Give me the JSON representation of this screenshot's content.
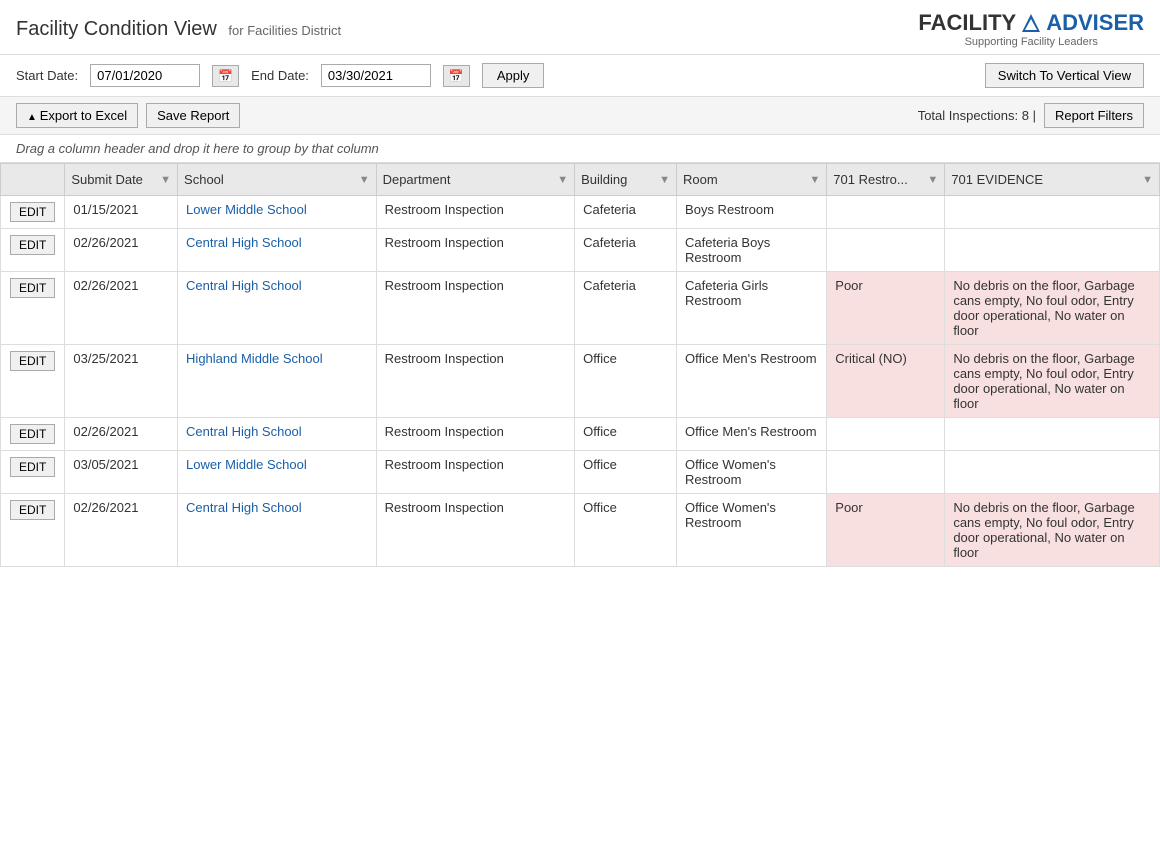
{
  "header": {
    "title": "Facility Condition View",
    "subtitle": "for Facilities District",
    "logo_main": "FACILITY",
    "logo_accent": "ADVISER",
    "logo_sub": "Supporting Facility Leaders"
  },
  "toolbar": {
    "start_date_label": "Start Date:",
    "start_date_value": "07/01/2020",
    "end_date_label": "End Date:",
    "end_date_value": "03/30/2021",
    "apply_label": "Apply",
    "switch_label": "Switch To Vertical View"
  },
  "action_bar": {
    "export_label": "Export to Excel",
    "save_label": "Save Report",
    "total_label": "Total Inspections: 8 |",
    "filters_label": "Report Filters"
  },
  "drag_hint": "Drag a column header and drop it here to group by that column",
  "table": {
    "columns": [
      {
        "key": "edit",
        "label": ""
      },
      {
        "key": "submit_date",
        "label": "Submit Date"
      },
      {
        "key": "school",
        "label": "School"
      },
      {
        "key": "department",
        "label": "Department"
      },
      {
        "key": "building",
        "label": "Building"
      },
      {
        "key": "room",
        "label": "Room"
      },
      {
        "key": "col701restro",
        "label": "701 Restro..."
      },
      {
        "key": "col701evidence",
        "label": "701 EVIDENCE"
      }
    ],
    "rows": [
      {
        "id": 1,
        "edit": "EDIT",
        "submit_date": "01/15/2021",
        "school": "Lower Middle School",
        "department": "Restroom Inspection",
        "building": "Cafeteria",
        "room": "Boys Restroom",
        "col701restro": "",
        "col701evidence": "",
        "highlight": false
      },
      {
        "id": 2,
        "edit": "EDIT",
        "submit_date": "02/26/2021",
        "school": "Central High School",
        "department": "Restroom Inspection",
        "building": "Cafeteria",
        "room": "Cafeteria Boys Restroom",
        "col701restro": "",
        "col701evidence": "",
        "highlight": false
      },
      {
        "id": 3,
        "edit": "EDIT",
        "submit_date": "02/26/2021",
        "school": "Central High School",
        "department": "Restroom Inspection",
        "building": "Cafeteria",
        "room": "Cafeteria Girls Restroom",
        "col701restro": "Poor",
        "col701evidence": "No debris on the floor, Garbage cans empty, No foul odor, Entry door operational, No water on floor",
        "highlight": true
      },
      {
        "id": 4,
        "edit": "EDIT",
        "submit_date": "03/25/2021",
        "school": "Highland Middle School",
        "department": "Restroom Inspection",
        "building": "Office",
        "room": "Office Men's Restroom",
        "col701restro": "Critical (NO)",
        "col701evidence": "No debris on the floor, Garbage cans empty, No foul odor, Entry door operational, No water on floor",
        "highlight": true
      },
      {
        "id": 5,
        "edit": "EDIT",
        "submit_date": "02/26/2021",
        "school": "Central High School",
        "department": "Restroom Inspection",
        "building": "Office",
        "room": "Office Men's Restroom",
        "col701restro": "",
        "col701evidence": "",
        "highlight": false
      },
      {
        "id": 6,
        "edit": "EDIT",
        "submit_date": "03/05/2021",
        "school": "Lower Middle School",
        "department": "Restroom Inspection",
        "building": "Office",
        "room": "Office Women's Restroom",
        "col701restro": "",
        "col701evidence": "",
        "highlight": false
      },
      {
        "id": 7,
        "edit": "EDIT",
        "submit_date": "02/26/2021",
        "school": "Central High School",
        "department": "Restroom Inspection",
        "building": "Office",
        "room": "Office Women's Restroom",
        "col701restro": "Poor",
        "col701evidence": "No debris on the floor, Garbage cans empty, No foul odor, Entry door operational, No water on floor",
        "highlight": true
      }
    ]
  }
}
